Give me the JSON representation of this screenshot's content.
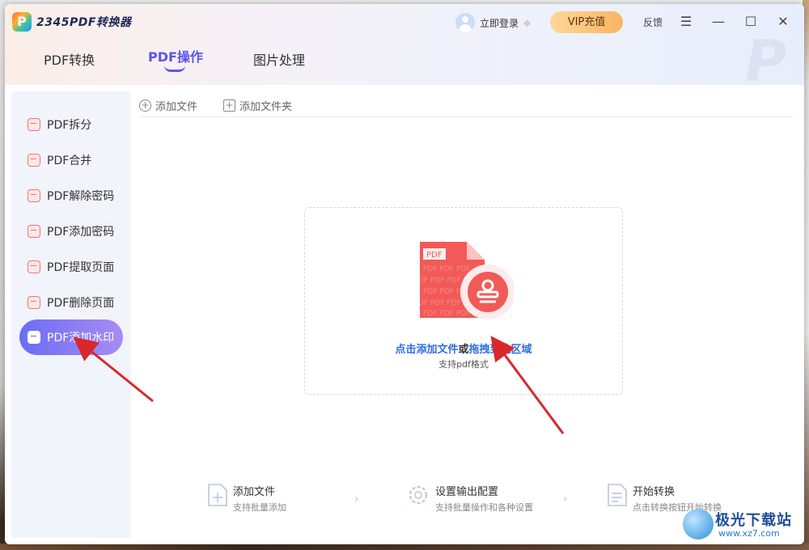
{
  "app": {
    "title": "2345PDF转换器"
  },
  "header": {
    "tabs": [
      {
        "label": "PDF转换"
      },
      {
        "label": "PDF操作"
      },
      {
        "label": "图片处理"
      }
    ],
    "login_label": "立即登录",
    "vip_label": "VIP充值",
    "feedback_label": "反馈"
  },
  "sidebar": {
    "items": [
      {
        "label": "PDF拆分",
        "icon": "split-icon"
      },
      {
        "label": "PDF合并",
        "icon": "merge-icon"
      },
      {
        "label": "PDF解除密码",
        "icon": "unlock-icon"
      },
      {
        "label": "PDF添加密码",
        "icon": "lock-icon"
      },
      {
        "label": "PDF提取页面",
        "icon": "extract-icon"
      },
      {
        "label": "PDF删除页面",
        "icon": "trash-icon"
      },
      {
        "label": "PDF添加水印",
        "icon": "watermark-icon",
        "active": true
      }
    ]
  },
  "toolbar": {
    "add_file": "添加文件",
    "add_folder": "添加文件夹"
  },
  "dropzone": {
    "doc_badge": "PDF",
    "text_link1": "点击添加文件",
    "text_or": "或",
    "text_link2": "拖拽到此区域",
    "sub": "支持pdf格式"
  },
  "steps": [
    {
      "title": "添加文件",
      "sub": "支持批量添加"
    },
    {
      "title": "设置输出配置",
      "sub": "支持批量操作和各种设置"
    },
    {
      "title": "开始转换",
      "sub": "点击转换按钮开始转换"
    }
  ],
  "watermark_site": {
    "name": "极光下载站",
    "url": "www.xz7.com"
  },
  "colors": {
    "accent": "#5a55e8",
    "vip": "#f7b55f",
    "link": "#2f6de4",
    "pdf_red": "#f25a57"
  }
}
